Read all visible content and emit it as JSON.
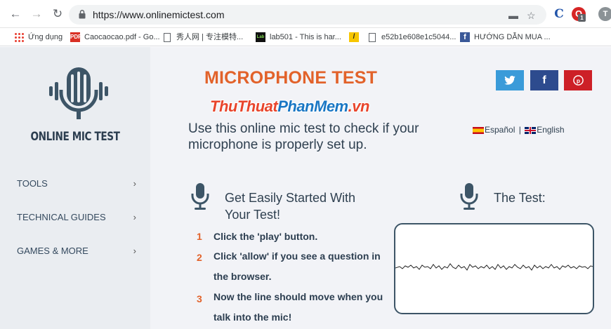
{
  "browser": {
    "url": "https://www.onlinemictest.com",
    "extension_c": "C",
    "profile_initial": "T",
    "ext_badge": "1"
  },
  "bookmarks": [
    {
      "label": "Ứng dụng"
    },
    {
      "label": "Caocaocao.pdf - Go..."
    },
    {
      "label": "秀人网 | 专注模特..."
    },
    {
      "label": "lab501 - This is har..."
    },
    {
      "label": "e52b1e608e1c5044..."
    },
    {
      "label": "HƯỚNG DẪN MUA ..."
    }
  ],
  "sidebar": {
    "logo_text": "ONLINE MIC TEST",
    "items": [
      {
        "label": "TOOLS"
      },
      {
        "label": "TECHNICAL GUIDES"
      },
      {
        "label": "GAMES & MORE"
      }
    ]
  },
  "main": {
    "title": "MICROPHONE TEST",
    "watermark_a": "ThuThuat",
    "watermark_b": "PhanMem",
    "watermark_c": ".vn",
    "subtitle": "Use this online mic test to check if your microphone is properly set up.",
    "lang_es": "Español",
    "lang_sep": "|",
    "lang_en": "English",
    "social": {
      "twitter_color": "#3a9bd9",
      "facebook_color": "#2d4b8e",
      "pinterest_color": "#cd2027"
    },
    "getting_started_title": "Get Easily Started With Your Test!",
    "test_title": "The Test:",
    "steps": [
      {
        "num": "1",
        "text": "Click the 'play' button."
      },
      {
        "num": "2",
        "text": "Click 'allow' if you see a question in the browser."
      },
      {
        "num": "3",
        "text": "Now the line should move when you talk into the mic!"
      }
    ]
  },
  "colors": {
    "accent": "#e2622a",
    "navy": "#2c3e50",
    "mic": "#3d5567"
  }
}
